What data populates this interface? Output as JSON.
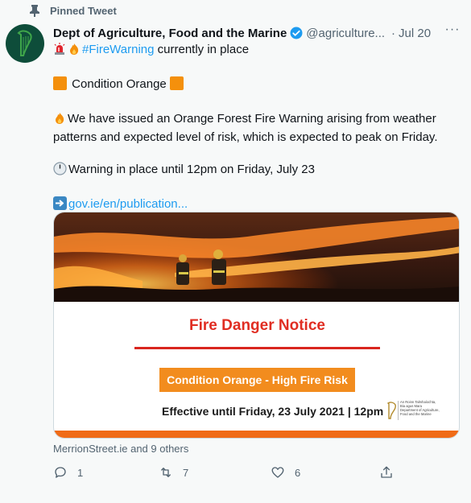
{
  "pinned": {
    "label": "Pinned Tweet",
    "icon": "pin-icon"
  },
  "account": {
    "display_name": "Dept of Agriculture, Food and the Marine",
    "handle": "@agriculture...",
    "date": "Jul 20",
    "verified": true,
    "avatar_icon": "harp-icon"
  },
  "tweet": {
    "line1_hashtag": "#FireWarning",
    "line1_rest": " currently in place",
    "condition": "Condition Orange",
    "paragraph": "We have issued an Orange Forest Fire Warning arising from weather patterns and expected level of risk, which is expected to peak on Friday.",
    "warning_until": "Warning in place until 12pm on Friday, July 23",
    "link": "gov.ie/en/publication..."
  },
  "card": {
    "notice_title": "Fire Danger Notice",
    "condition_label": "Condition Orange - High Fire Risk",
    "effective": "Effective until Friday, 23 July 2021 | 12pm",
    "dept_logo_text": [
      "An Roinn Talmhaíochta,",
      "Bia agus Mara",
      "Department of Agriculture,",
      "Food and the Marine"
    ]
  },
  "likers": "MerrionStreet.ie and 9 others",
  "actions": {
    "reply_count": "1",
    "retweet_count": "7",
    "like_count": "6"
  },
  "colors": {
    "accent": "#1d9bf0",
    "notice_red": "#e02d22",
    "condition_orange": "#f28c1e",
    "band_orange": "#f06b17"
  }
}
